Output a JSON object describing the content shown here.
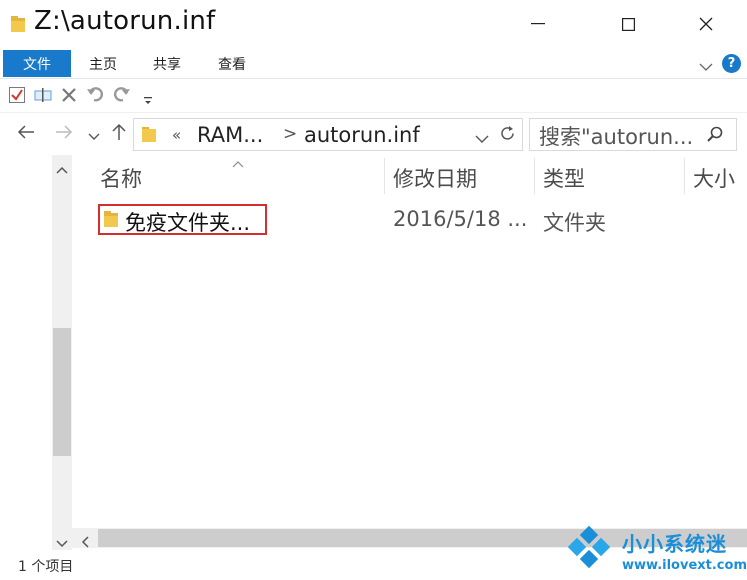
{
  "window": {
    "title": "Z:\\autorun.inf",
    "controls": [
      "minimize",
      "maximize",
      "close"
    ]
  },
  "ribbon": {
    "file_tab": "文件",
    "tabs": [
      "主页",
      "共享",
      "查看"
    ],
    "help": "?"
  },
  "nav": {
    "breadcrumb_overflow": "«",
    "crumb_1": "RAM...",
    "crumb_sep": ">",
    "crumb_2": "autorun.inf"
  },
  "search": {
    "placeholder": "搜索\"autorun..."
  },
  "columns": {
    "name": "名称",
    "date": "修改日期",
    "type": "类型",
    "size": "大小"
  },
  "rows": [
    {
      "name": "免疫文件夹...",
      "date": "2016/5/18 ...",
      "type": "文件夹"
    }
  ],
  "status": {
    "count": "1 个项目"
  },
  "watermark": {
    "title": "小小系统迷",
    "url": "www.ilovext.com"
  },
  "colors": {
    "accent": "#1979ca",
    "highlight_box": "#d42f2f",
    "folder": "#f2c94c",
    "watermark": "#1a8fd8"
  }
}
